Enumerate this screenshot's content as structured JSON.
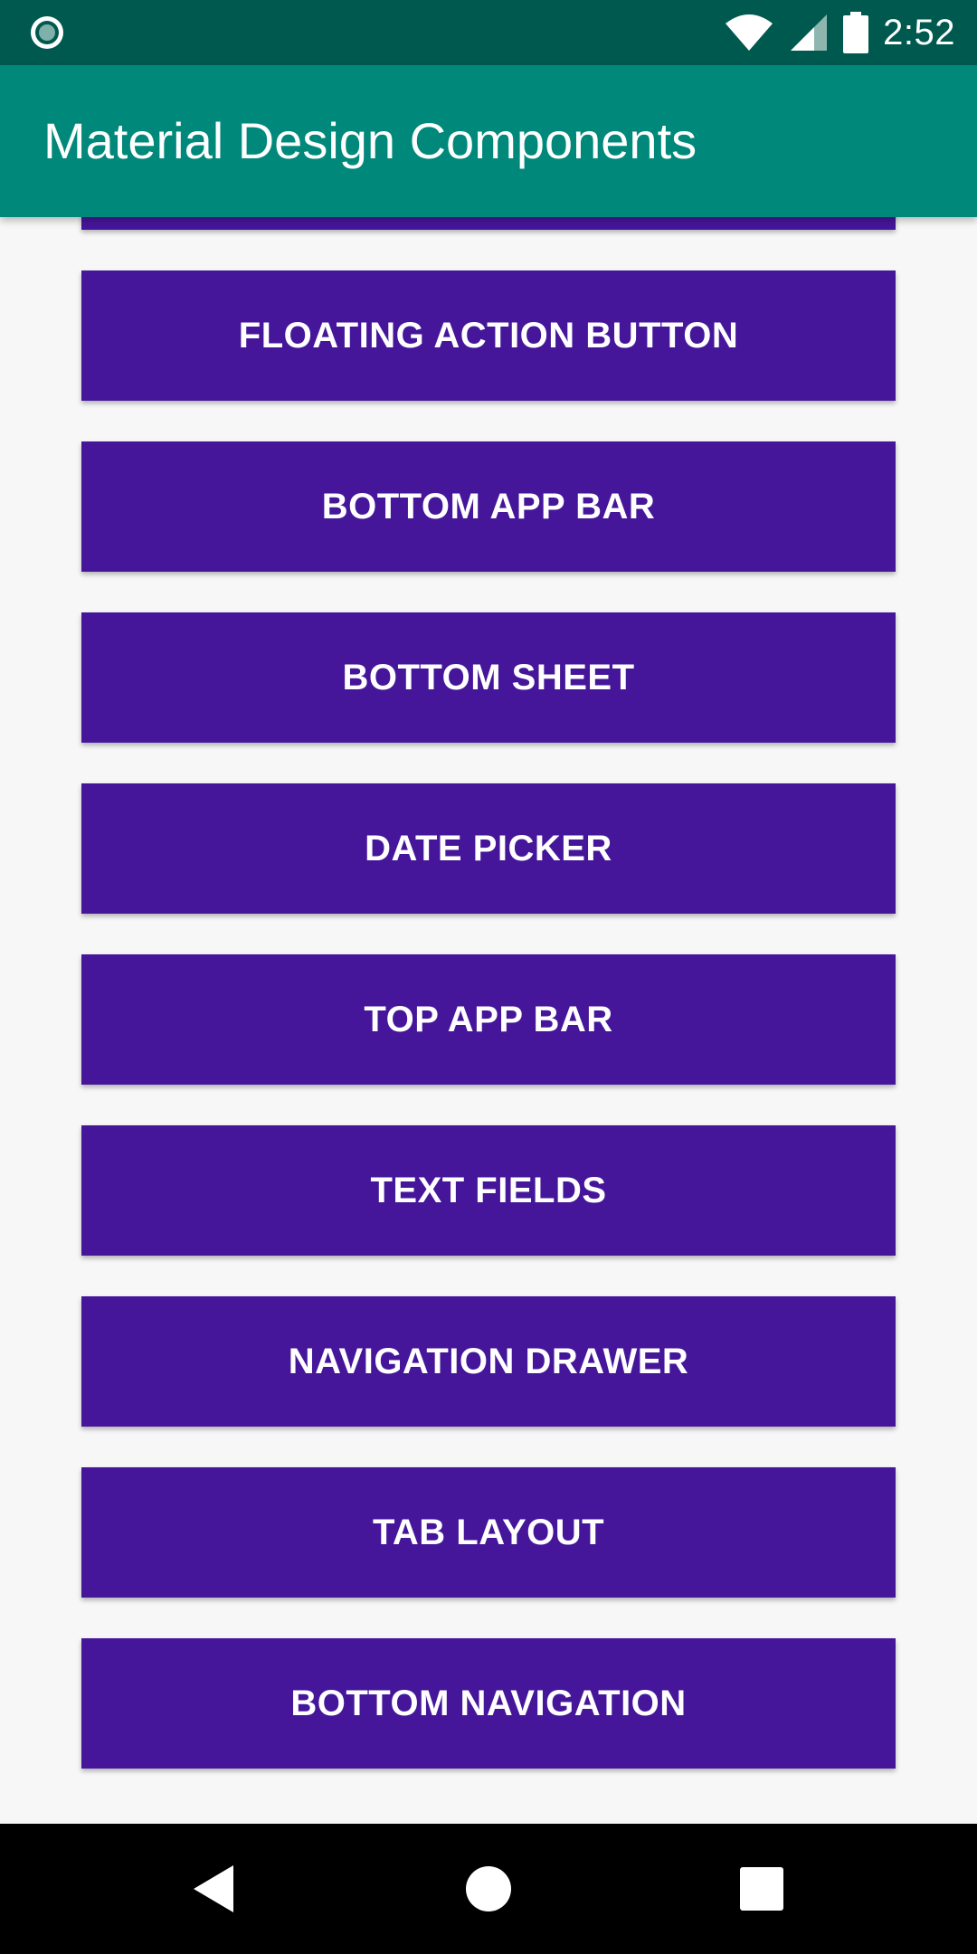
{
  "status_bar": {
    "time": "2:52",
    "icons": [
      "app-notification-icon",
      "wifi-icon",
      "signal-icon",
      "battery-icon"
    ]
  },
  "app_bar": {
    "title": "Material Design Components"
  },
  "buttons": [
    "FLOATING ACTION BUTTON",
    "BOTTOM APP BAR",
    "BOTTOM SHEET",
    "DATE PICKER",
    "TOP APP BAR",
    "TEXT FIELDS",
    "NAVIGATION DRAWER",
    "TAB LAYOUT",
    "BOTTOM NAVIGATION"
  ],
  "navigation_bar": {
    "icons": [
      "back-icon",
      "home-icon",
      "recent-apps-icon"
    ]
  },
  "colors": {
    "status_bar": "#00594f",
    "app_bar": "#00897b",
    "button": "#45169a",
    "background": "#f7f7f7",
    "nav_bar": "#000000"
  }
}
